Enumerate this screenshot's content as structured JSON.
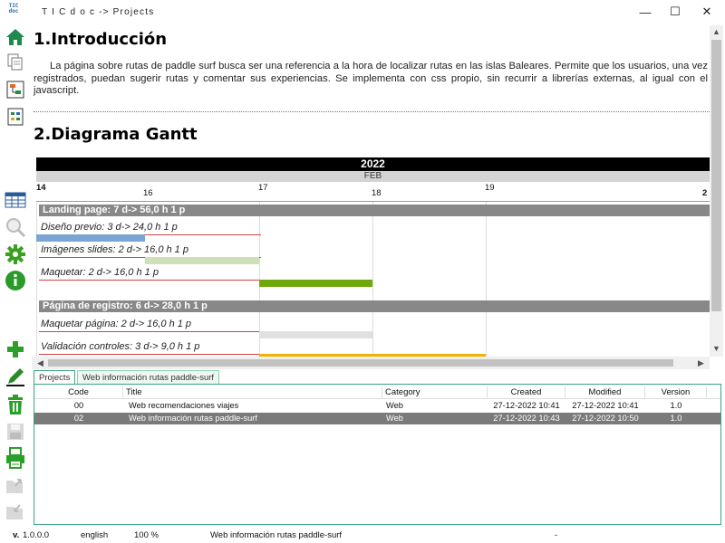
{
  "window": {
    "logo": "TIC doc",
    "title": "T I C d o c -> Projects",
    "minimize": "—",
    "maximize": "☐",
    "close": "✕"
  },
  "toolbar_icons": [
    "home-icon",
    "documents-icon",
    "diagram-icon",
    "sheet-icon",
    "table-icon",
    "magnifier-icon",
    "gear-icon",
    "info-icon",
    "add-icon",
    "edit-icon",
    "trash-icon",
    "save-icon",
    "print-icon",
    "export-icon",
    "import-icon"
  ],
  "doc": {
    "h1": "1.Introducción",
    "intro": "La página sobre rutas de paddle surf busca ser una referencia a la hora de localizar rutas en las islas Baleares. Permite que los usuarios, una vez registrados, puedan sugerir rutas y comentar sus experiencias. Se implementa con css propio, sin recurrir a librerías externas, al igual con el javascript.",
    "h2": "2.Diagrama Gantt"
  },
  "gantt": {
    "year": "2022",
    "month": "FEB",
    "days": [
      {
        "label": "14",
        "bold": true
      },
      {
        "label": "16",
        "bold": false
      },
      {
        "label": "17",
        "bold": false
      },
      {
        "label": "18",
        "bold": false
      },
      {
        "label": "19",
        "bold": false
      },
      {
        "label": "2",
        "bold": true
      }
    ],
    "groups": [
      {
        "label": "Landing page: 7 d-> 56,0 h 1 p",
        "tasks": [
          {
            "label": "Diseño previo: 3 d-> 24,0 h 1 p",
            "color": "#7aa4d4"
          },
          {
            "label": "Imágenes slides: 2 d-> 16,0 h 1 p",
            "color": "#cfe0b8"
          },
          {
            "label": "Maquetar: 2 d-> 16,0 h 1 p",
            "color": "#6ea80a"
          }
        ]
      },
      {
        "label": "Página de registro: 6 d-> 28,0 h 1 p",
        "tasks": [
          {
            "label": "Maquetar página: 2 d-> 16,0 h 1 p",
            "color": "#e0e0e0"
          },
          {
            "label": "Validación controles: 3 d-> 9,0 h 1 p",
            "color": "#f0b400"
          }
        ]
      }
    ]
  },
  "tabs": [
    "Projects",
    "Web información rutas paddle-surf"
  ],
  "table": {
    "columns": [
      "Code",
      "Title",
      "Category",
      "Created",
      "Modified",
      "Version"
    ],
    "rows": [
      {
        "code": "00",
        "title": "Web recomendaciones viajes",
        "category": "Web",
        "created": "27-12-2022 10:41",
        "modified": "27-12-2022 10:41",
        "version": "1.0",
        "selected": false
      },
      {
        "code": "02",
        "title": "Web información rutas paddle-surf",
        "category": "Web",
        "created": "27-12-2022 10:43",
        "modified": "27-12-2022 10:50",
        "version": "1.0",
        "selected": true
      }
    ]
  },
  "status": {
    "version_label": "v.",
    "version": "1.0.0.0",
    "language": "english",
    "zoom": "100 %",
    "project": "Web información rutas paddle-surf",
    "extra": "-"
  },
  "colors": {
    "accent": "#3aa47f",
    "selected_row": "#7a7a7a",
    "group_bar": "#888888"
  }
}
